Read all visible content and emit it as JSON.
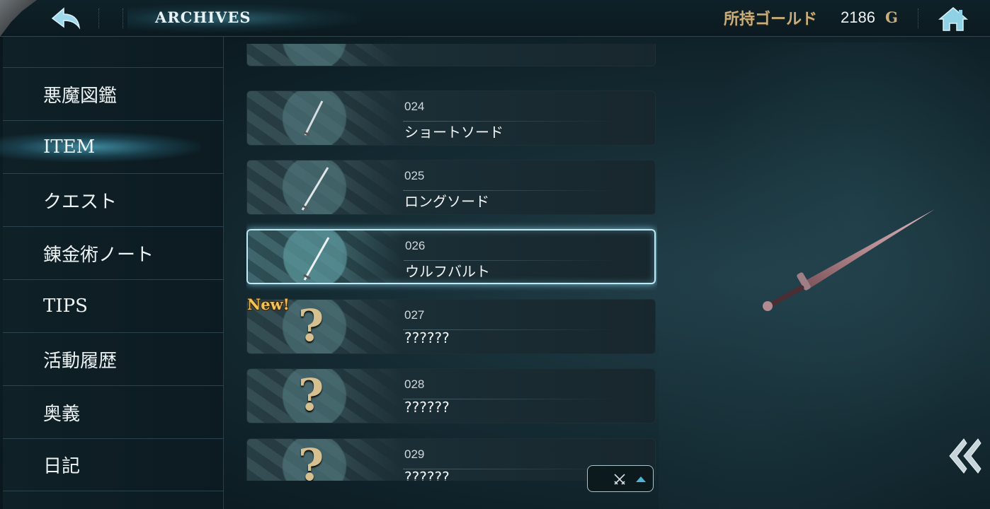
{
  "header": {
    "title": "ARCHIVES",
    "gold_label": "所持ゴールド",
    "gold_value": "2186",
    "gold_unit": "G",
    "back_icon": "back-arrow-icon",
    "home_icon": "home-icon"
  },
  "sidebar": {
    "items": [
      {
        "label": "悪魔図鑑",
        "active": false
      },
      {
        "label": "ITEM",
        "active": true
      },
      {
        "label": "クエスト",
        "active": false
      },
      {
        "label": "錬金術ノート",
        "active": false
      },
      {
        "label": "TIPS",
        "active": false
      },
      {
        "label": "活動履歴",
        "active": false
      },
      {
        "label": "奥義",
        "active": false
      },
      {
        "label": "日記",
        "active": false
      }
    ]
  },
  "list": {
    "rows": [
      {
        "num": "024",
        "name": "ショートソード",
        "icon": "short-sword-icon"
      },
      {
        "num": "025",
        "name": "ロングソード",
        "icon": "long-sword-icon"
      },
      {
        "num": "026",
        "name": "ウルフバルト",
        "icon": "ulfberht-sword-icon",
        "selected": true
      },
      {
        "num": "027",
        "name": "??????",
        "icon": "question-mark-icon",
        "badge": "New!"
      },
      {
        "num": "028",
        "name": "??????",
        "icon": "question-mark-icon"
      },
      {
        "num": "029",
        "name": "??????",
        "icon": "question-mark-icon"
      }
    ],
    "unknown_symbol": "?"
  },
  "sort": {
    "icon": "crossed-swords-icon",
    "direction": "ascending"
  },
  "preview": {
    "icon": "sword-preview-icon"
  },
  "colors": {
    "accent": "#4fb3d4",
    "gold": "#c9ad7a",
    "badge": "#f0c25a"
  }
}
